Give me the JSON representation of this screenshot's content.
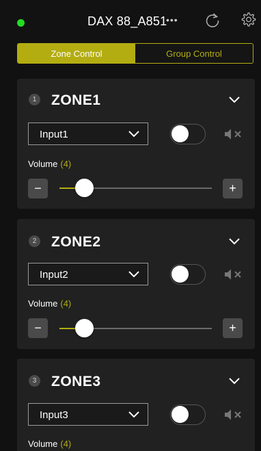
{
  "header": {
    "device_name": "DAX 88_A851",
    "more_label": "•••",
    "status_color": "#22dd22",
    "refresh_icon": "refresh-icon",
    "settings_icon": "gear-icon"
  },
  "tabs": [
    {
      "label": "Zone Control",
      "active": true
    },
    {
      "label": "Group Control",
      "active": false
    }
  ],
  "accent_color": "#b3ad12",
  "zones": [
    {
      "number": "1",
      "name": "ZONE1",
      "input": "Input1",
      "power_on": false,
      "muted": true,
      "volume_label": "Volume",
      "volume_value": "(4)",
      "minus": "−",
      "plus": "+",
      "slider_fraction": 0.16
    },
    {
      "number": "2",
      "name": "ZONE2",
      "input": "Input2",
      "power_on": false,
      "muted": true,
      "volume_label": "Volume",
      "volume_value": "(4)",
      "minus": "−",
      "plus": "+",
      "slider_fraction": 0.16
    },
    {
      "number": "3",
      "name": "ZONE3",
      "input": "Input3",
      "power_on": false,
      "muted": true,
      "volume_label": "Volume",
      "volume_value": "(4)",
      "minus": "−",
      "plus": "+",
      "slider_fraction": 0.16
    }
  ]
}
